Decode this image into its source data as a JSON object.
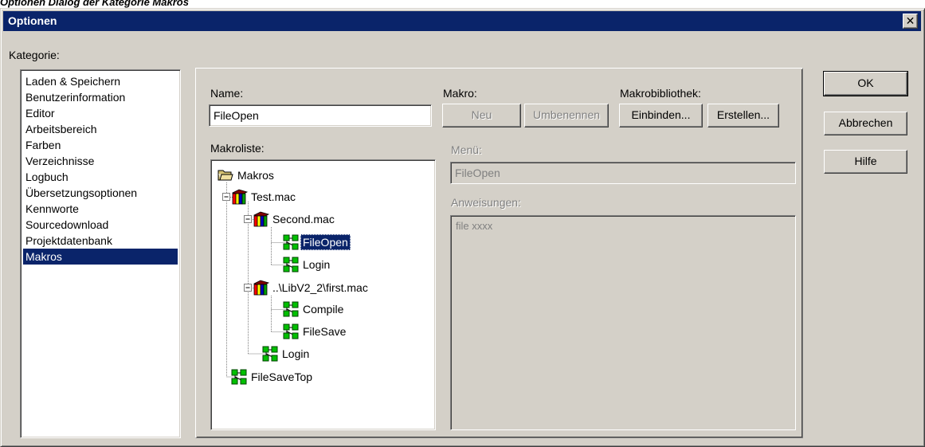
{
  "caption": "Optionen Dialog der Kategorie Makros",
  "window": {
    "title": "Optionen",
    "close_glyph": "✕"
  },
  "kategorie": {
    "label": "Kategorie:",
    "items": [
      "Laden & Speichern",
      "Benutzerinformation",
      "Editor",
      "Arbeitsbereich",
      "Farben",
      "Verzeichnisse",
      "Logbuch",
      "Übersetzungsoptionen",
      "Kennworte",
      "Sourcedownload",
      "Projektdatenbank",
      "Makros"
    ],
    "selected": "Makros"
  },
  "name": {
    "label": "Name:",
    "value": "FileOpen"
  },
  "makro": {
    "label": "Makro:",
    "neu_label": "Neu",
    "umbenennen_label": "Umbenennen"
  },
  "bibliothek": {
    "label": "Makrobibliothek:",
    "einbinden_label": "Einbinden...",
    "erstellen_label": "Erstellen..."
  },
  "makroliste": {
    "label": "Makroliste:",
    "nodes": [
      {
        "id": "root",
        "label": "Makros",
        "icon": "folder-icon"
      },
      {
        "id": "testmac",
        "label": "Test.mac",
        "icon": "library-books-icon"
      },
      {
        "id": "secondmac",
        "label": "Second.mac",
        "icon": "library-books-icon"
      },
      {
        "id": "fileopen",
        "label": "FileOpen",
        "icon": "macro-icon",
        "selected": true
      },
      {
        "id": "login1",
        "label": "Login",
        "icon": "macro-icon"
      },
      {
        "id": "firstmac",
        "label": "..\\LibV2_2\\first.mac",
        "icon": "library-books-icon"
      },
      {
        "id": "compile",
        "label": "Compile",
        "icon": "macro-icon"
      },
      {
        "id": "filesave",
        "label": "FileSave",
        "icon": "macro-icon"
      },
      {
        "id": "login2",
        "label": "Login",
        "icon": "macro-icon"
      },
      {
        "id": "filesavetop",
        "label": "FileSaveTop",
        "icon": "macro-icon"
      }
    ]
  },
  "menu": {
    "label": "Menü:",
    "value": "FileOpen"
  },
  "anweisungen": {
    "label": "Anweisungen:",
    "value": "file xxxx"
  },
  "buttons": {
    "ok": "OK",
    "abbrechen": "Abbrechen",
    "hilfe": "Hilfe"
  },
  "colors": {
    "face": "#d4d0c8",
    "title": "#0a246a",
    "selection": "#0a246a"
  }
}
